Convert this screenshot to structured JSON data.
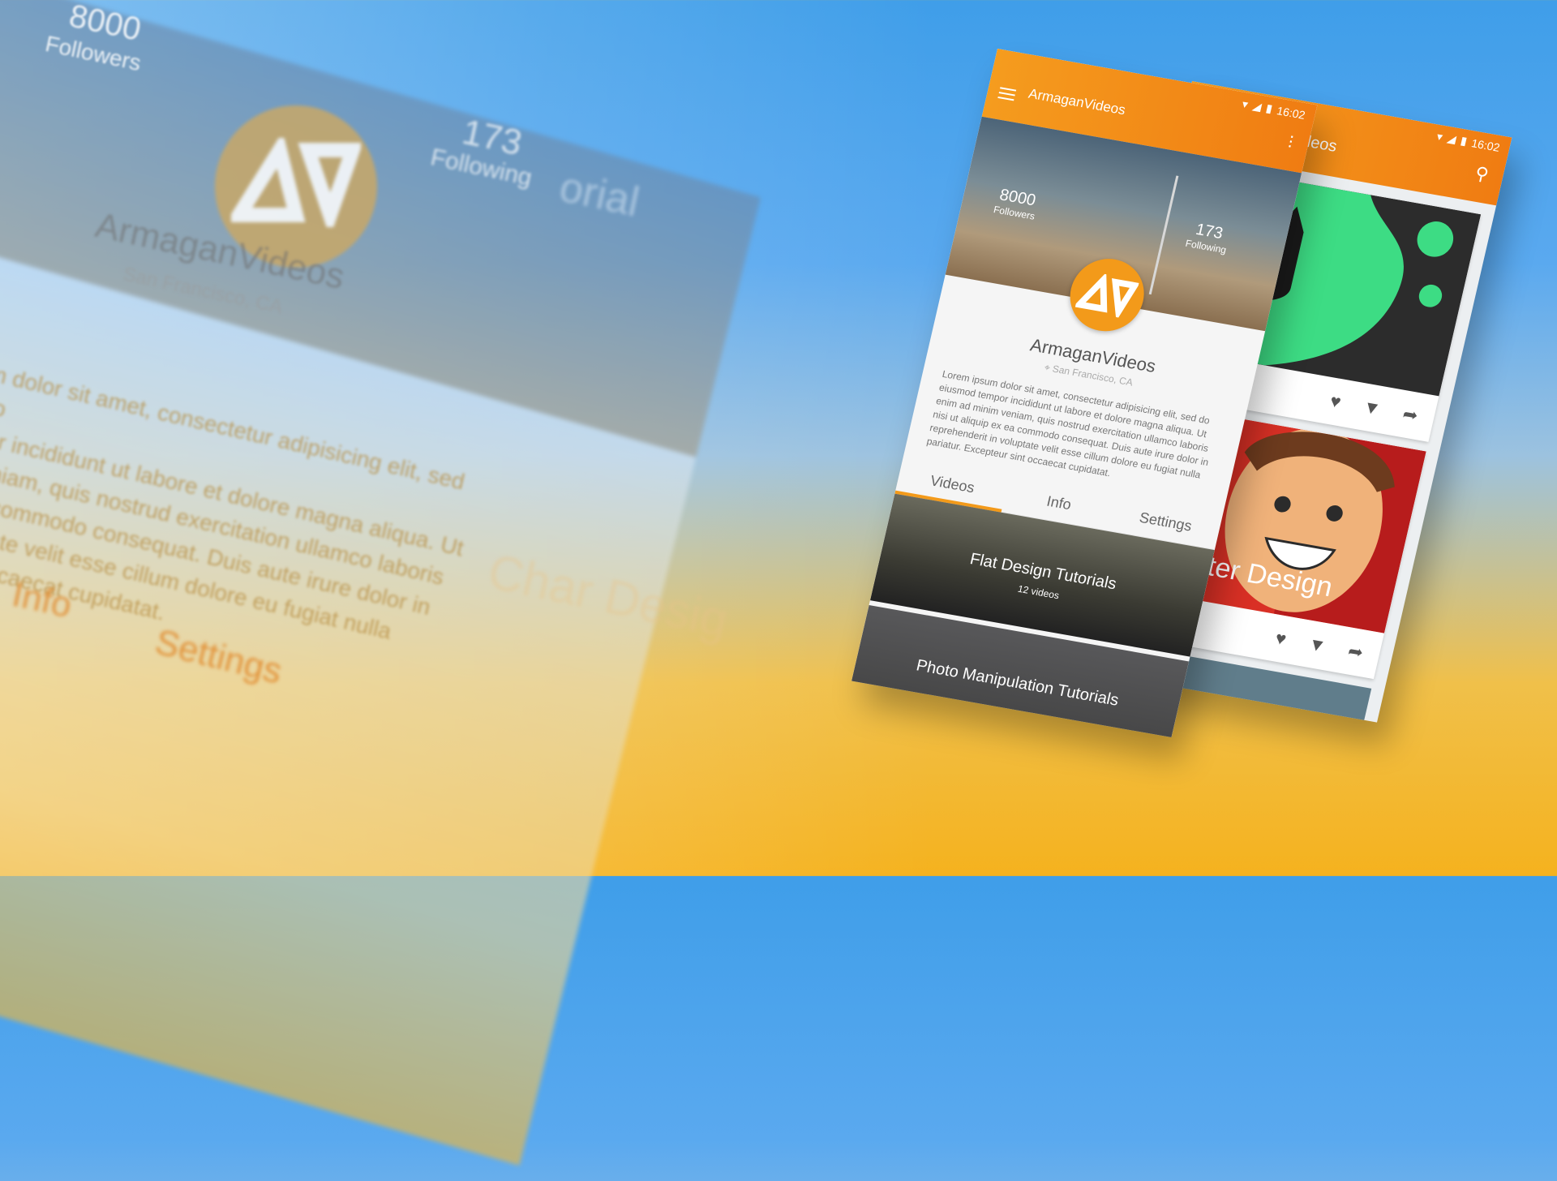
{
  "colors": {
    "accent": "#f39a1a",
    "appbar_end": "#f07c12",
    "sky": "#3f9ee9",
    "sunset": "#f5b21e"
  },
  "background": {
    "followers_num": "8000",
    "followers_label": "Followers",
    "following_num": "173",
    "following_label": "Following",
    "name": "ArmaganVideos",
    "location": "San Francisco, CA",
    "bio_lines": [
      "m dolor sit amet, consectetur adipisicing elit, sed do",
      "por incididunt ut labore et dolore magna aliqua. Ut",
      "veniam, quis nostrud exercitation ullamco laboris",
      "ea commodo consequat. Duis aute irure dolor in",
      "luptate velit esse cillum dolore eu fugiat nulla",
      "int occaecat cupidatat."
    ],
    "tab_info": "Info",
    "tab_settings": "Settings",
    "partial_word": "orial",
    "partial_card": "Char Desig"
  },
  "phone_front": {
    "status_time": "16:02",
    "title": "ArmaganVideos",
    "menu_icon": "hamburger-icon",
    "more_icon": "more-vert-icon",
    "followers_num": "8000",
    "followers_label": "Followers",
    "following_num": "173",
    "following_label": "Following",
    "name": "ArmaganVideos",
    "location": "San Francisco, CA",
    "bio": "Lorem ipsum dolor sit amet, consectetur adipisicing elit, sed do eiusmod tempor incididunt ut labore et dolore magna aliqua. Ut enim ad minim veniam, quis nostrud exercitation ullamco laboris nisi ut aliquip ex ea commodo consequat. Duis aute irure dolor in reprehenderit in voluptate velit esse cillum dolore eu fugiat nulla pariatur. Excepteur sint occaecat cupidatat.",
    "tabs": [
      "Videos",
      "Info",
      "Settings"
    ],
    "active_tab": "Videos",
    "videos": [
      {
        "title": "Flat Design Tutorials",
        "subtitle": "12 videos"
      },
      {
        "title": "Photo Manipulation Tutorials",
        "subtitle": ""
      }
    ]
  },
  "phone_back": {
    "status_time": "16:02",
    "title": "ArmaganVideos",
    "search_icon": "search-icon",
    "cards": [
      {
        "label": "orial",
        "art": "batman-art"
      },
      {
        "label": "Character Design",
        "art": "character-art"
      }
    ]
  }
}
